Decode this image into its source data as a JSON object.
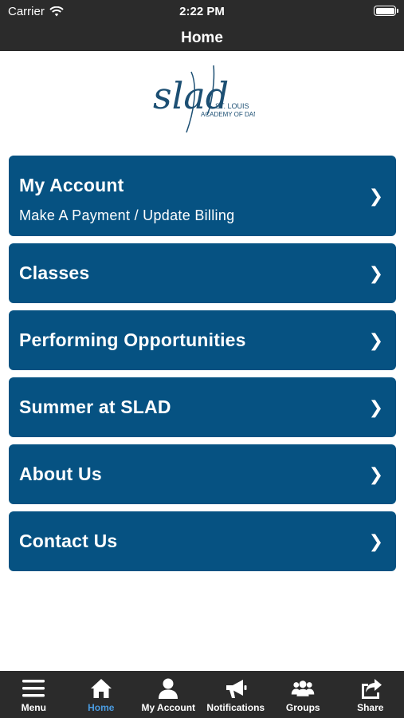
{
  "status": {
    "carrier": "Carrier",
    "time": "2:22 PM"
  },
  "nav": {
    "title": "Home"
  },
  "logo": {
    "main": "slad",
    "line1": "ST. LOUIS",
    "line2": "ACADEMY OF DANCE"
  },
  "menu": [
    {
      "title": "My Account",
      "subtitle": "Make A Payment / Update Billing"
    },
    {
      "title": "Classes"
    },
    {
      "title": "Performing Opportunities"
    },
    {
      "title": "Summer at SLAD"
    },
    {
      "title": "About Us"
    },
    {
      "title": "Contact Us"
    }
  ],
  "chevron": "❯",
  "tabs": [
    {
      "label": "Menu",
      "icon": "menu-icon"
    },
    {
      "label": "Home",
      "icon": "home-icon",
      "active": true
    },
    {
      "label": "My Account",
      "icon": "user-icon"
    },
    {
      "label": "Notifications",
      "icon": "megaphone-icon"
    },
    {
      "label": "Groups",
      "icon": "groups-icon"
    },
    {
      "label": "Share",
      "icon": "share-icon"
    }
  ],
  "colors": {
    "bar": "#2b2b2b",
    "card": "#065282",
    "active_tab": "#4a9be0"
  }
}
